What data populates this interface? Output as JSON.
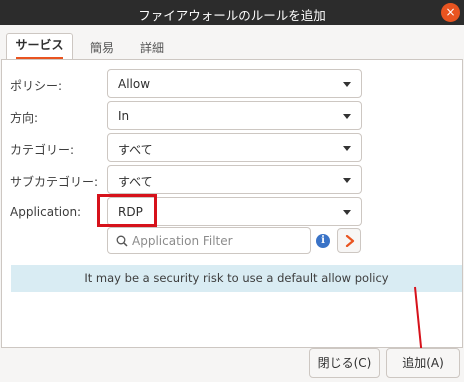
{
  "window": {
    "title": "ファイアウォールのルールを追加",
    "close_glyph": "×"
  },
  "tabs": [
    {
      "label": "サービス",
      "active": true
    },
    {
      "label": "簡易",
      "active": false
    },
    {
      "label": "詳細",
      "active": false
    }
  ],
  "form": {
    "policy": {
      "label": "ポリシー:",
      "value": "Allow"
    },
    "direction": {
      "label": "方向:",
      "value": "In"
    },
    "category": {
      "label": "カテゴリー:",
      "value": "すべて"
    },
    "subcategory": {
      "label": "サブカテゴリー:",
      "value": "すべて"
    },
    "application": {
      "label": "Application:",
      "value": "RDP"
    }
  },
  "filter": {
    "placeholder": "Application Filter",
    "info_glyph": "i"
  },
  "warning": {
    "message": "It may be a security risk to use a default allow policy"
  },
  "buttons": {
    "close_label": "閉じる(C)",
    "add_label": "追加(A)"
  },
  "colors": {
    "accent": "#e95420",
    "highlight": "#d6121b",
    "banner": "#d9ecf3"
  }
}
